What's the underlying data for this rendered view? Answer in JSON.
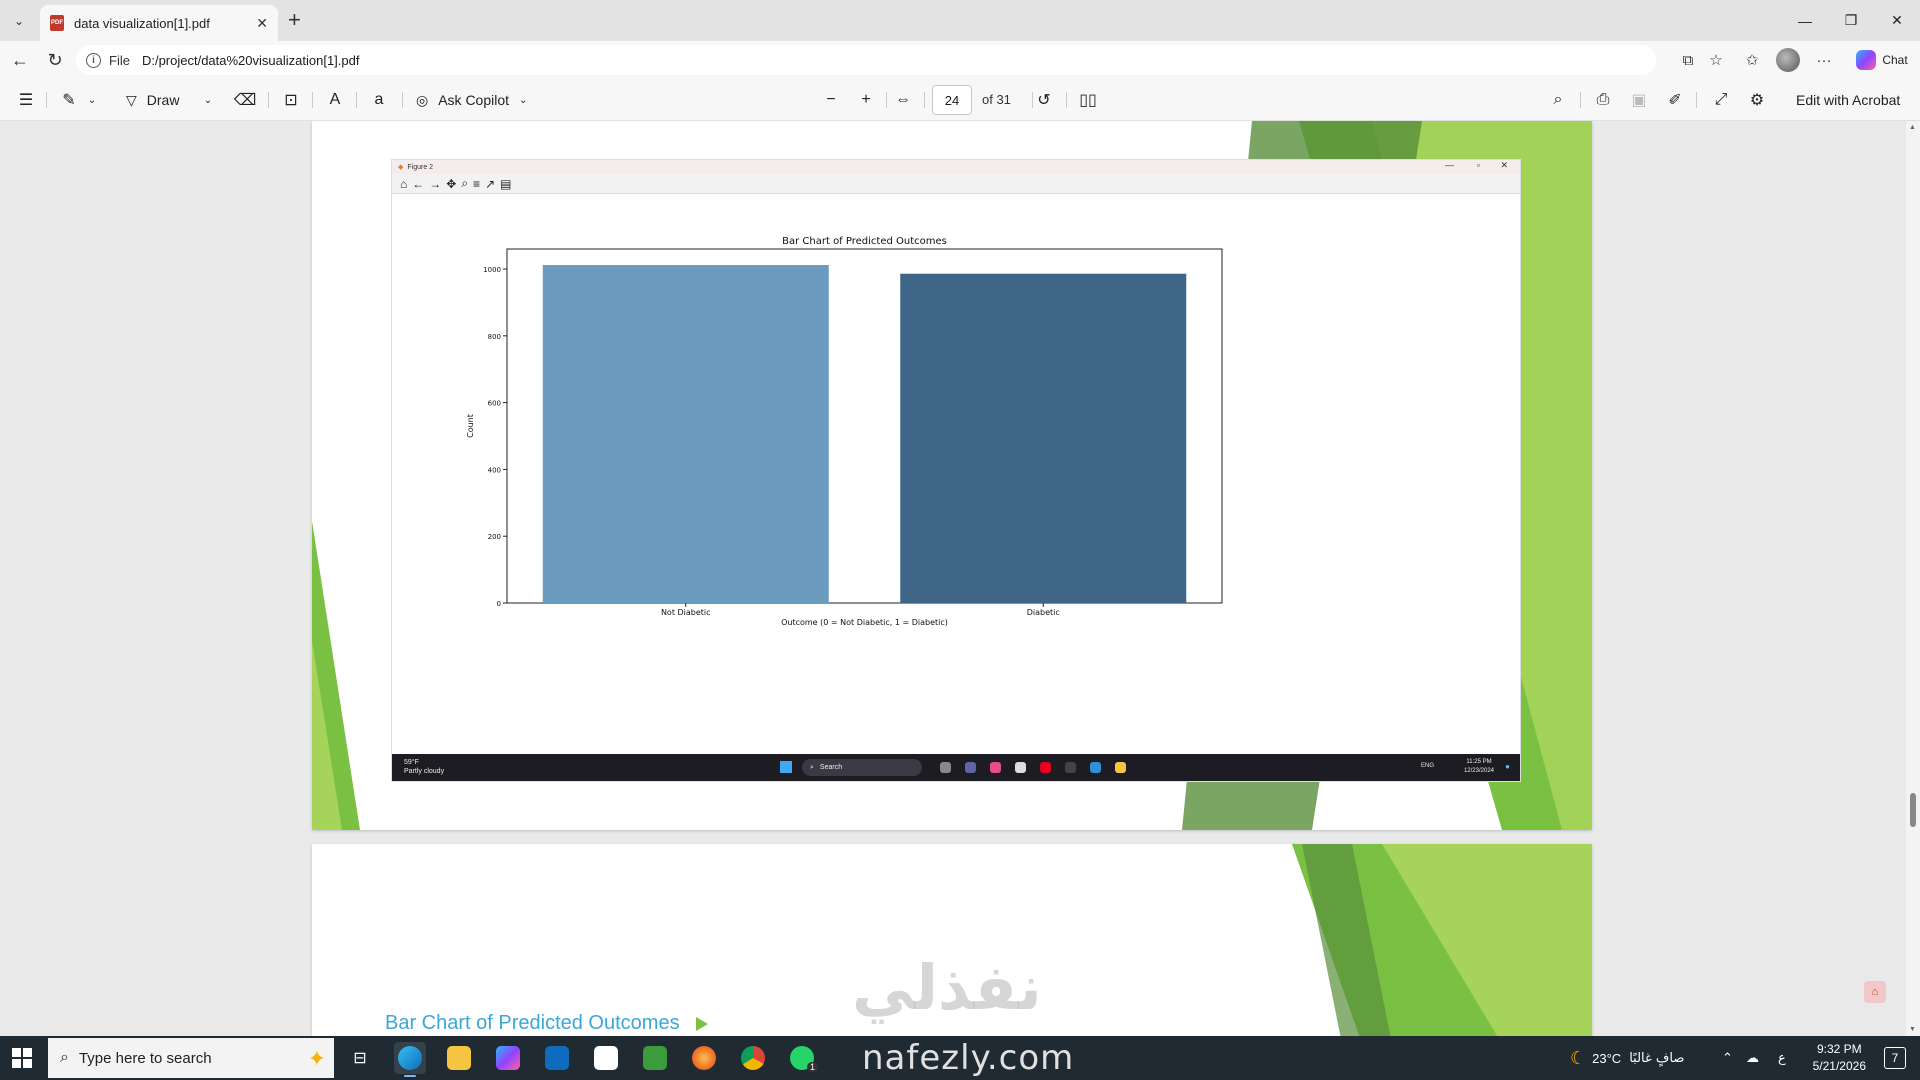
{
  "browser": {
    "tab_title": "data visualization[1].pdf",
    "tab_close": "✕",
    "new_tab": "+",
    "url_scheme": "File",
    "url": "D:/project/data%20visualization[1].pdf",
    "chat_label": "Chat"
  },
  "pdf_toolbar": {
    "draw_label": "Draw",
    "ask_copilot_label": "Ask Copilot",
    "page_number": "24",
    "page_total": "of 31",
    "edit_acrobat_label": "Edit with Acrobat"
  },
  "figure_window": {
    "title": "Figure 2"
  },
  "chart_data": {
    "type": "bar",
    "title": "Bar Chart of Predicted Outcomes",
    "xlabel": "Outcome (0 = Not Diabetic, 1 = Diabetic)",
    "ylabel": "Count",
    "categories": [
      "Not Diabetic",
      "Diabetic"
    ],
    "values": [
      1012,
      986
    ],
    "ylim": [
      0,
      1060
    ],
    "yticks": [
      0,
      200,
      400,
      600,
      800,
      1000
    ],
    "colors": [
      "#6c9bc0",
      "#3f6587"
    ],
    "grid": false
  },
  "inner_taskbar": {
    "weather_temp": "59°F",
    "weather_desc": "Partly cloudy",
    "search_label": "Search",
    "lang": "ENG",
    "time": "11:25 PM",
    "date": "12/23/2024"
  },
  "page2": {
    "heading": "Bar Chart of Predicted Outcomes"
  },
  "watermark": {
    "arabic": "نفذلي",
    "latin": "nafezly.com"
  },
  "taskbar": {
    "search_placeholder": "Type here to search",
    "whatsapp_badge": "1",
    "weather": "23°C",
    "weather_desc": "صافٍ غالبًا",
    "lang_indicator": "ع",
    "time": "9:32 PM",
    "date": "5/21/2026",
    "notif_count": "7"
  },
  "colors": {
    "accent_green": "#7ac143",
    "heading_blue": "#3aa7d6",
    "taskbar_bg": "#1f2a33"
  }
}
